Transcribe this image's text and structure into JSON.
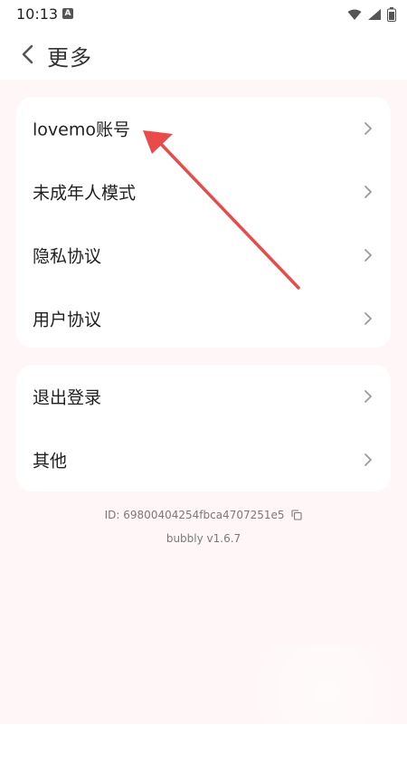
{
  "status_bar": {
    "time": "10:13",
    "notification_icon": "a-icon",
    "icons": [
      "wifi-icon",
      "signal-icon",
      "battery-icon"
    ]
  },
  "header": {
    "title": "更多",
    "back_icon": "chevron-left-icon"
  },
  "menu_group_1": [
    {
      "label": "lovemo账号"
    },
    {
      "label": "未成年人模式"
    },
    {
      "label": "隐私协议"
    },
    {
      "label": "用户协议"
    }
  ],
  "menu_group_2": [
    {
      "label": "退出登录"
    },
    {
      "label": "其他"
    }
  ],
  "footer": {
    "user_id": "ID: 69800404254fbca4707251e5",
    "copy_icon": "copy-icon",
    "version": "bubbly v1.6.7"
  },
  "colors": {
    "background": "#fff7f7",
    "card": "#ffffff",
    "annotation_arrow": "#e94b4b"
  }
}
